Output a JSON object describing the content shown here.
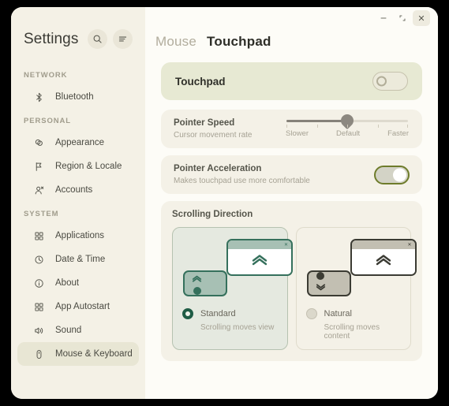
{
  "window": {
    "controls": {
      "minimize": "minimize",
      "maximize": "maximize",
      "close": "×"
    }
  },
  "sidebar": {
    "app_title": "Settings",
    "search_icon": "search-icon",
    "menu_icon": "menu-icon",
    "groups": [
      {
        "label": "NETWORK",
        "items": [
          {
            "label": "Bluetooth",
            "icon": "bluetooth-icon",
            "selected": false
          }
        ]
      },
      {
        "label": "PERSONAL",
        "items": [
          {
            "label": "Appearance",
            "icon": "appearance-icon",
            "selected": false
          },
          {
            "label": "Region & Locale",
            "icon": "flag-icon",
            "selected": false
          },
          {
            "label": "Accounts",
            "icon": "accounts-icon",
            "selected": false
          }
        ]
      },
      {
        "label": "SYSTEM",
        "items": [
          {
            "label": "Applications",
            "icon": "grid-icon",
            "selected": false
          },
          {
            "label": "Date & Time",
            "icon": "clock-icon",
            "selected": false
          },
          {
            "label": "About",
            "icon": "info-icon",
            "selected": false
          },
          {
            "label": "App Autostart",
            "icon": "grid-icon",
            "selected": false
          },
          {
            "label": "Sound",
            "icon": "speaker-icon",
            "selected": false
          },
          {
            "label": "Mouse & Keyboard",
            "icon": "mouse-icon",
            "selected": true
          }
        ]
      }
    ]
  },
  "main": {
    "tabs": [
      {
        "label": "Mouse",
        "active": false
      },
      {
        "label": "Touchpad",
        "active": true
      }
    ],
    "touchpad_card": {
      "title": "Touchpad",
      "toggle_state": "off"
    },
    "pointer_speed": {
      "label": "Pointer Speed",
      "sublabel": "Cursor movement rate",
      "value_label": "Default",
      "min_label": "Slower",
      "max_label": "Faster",
      "percent": 50
    },
    "pointer_acceleration": {
      "label": "Pointer Acceleration",
      "sublabel": "Makes touchpad use more comfortable",
      "toggle_state": "on"
    },
    "scrolling_direction": {
      "heading": "Scrolling Direction",
      "options": [
        {
          "name": "Standard",
          "description": "Scrolling moves view",
          "selected": true
        },
        {
          "name": "Natural",
          "description": "Scrolling moves content",
          "selected": false
        }
      ]
    }
  },
  "colors": {
    "sidebar_bg": "#f4f1e6",
    "main_bg": "#fdfcf7",
    "card_bg": "#f4f1e7",
    "accent_card_bg": "#e7e9d3",
    "selected_choice_bg": "#e5e9e0",
    "toggle_on_border": "#6e7c2b",
    "radio_on": "#1f5c45",
    "illustration_green": "#35705c",
    "illustration_dark": "#3b3b33"
  }
}
